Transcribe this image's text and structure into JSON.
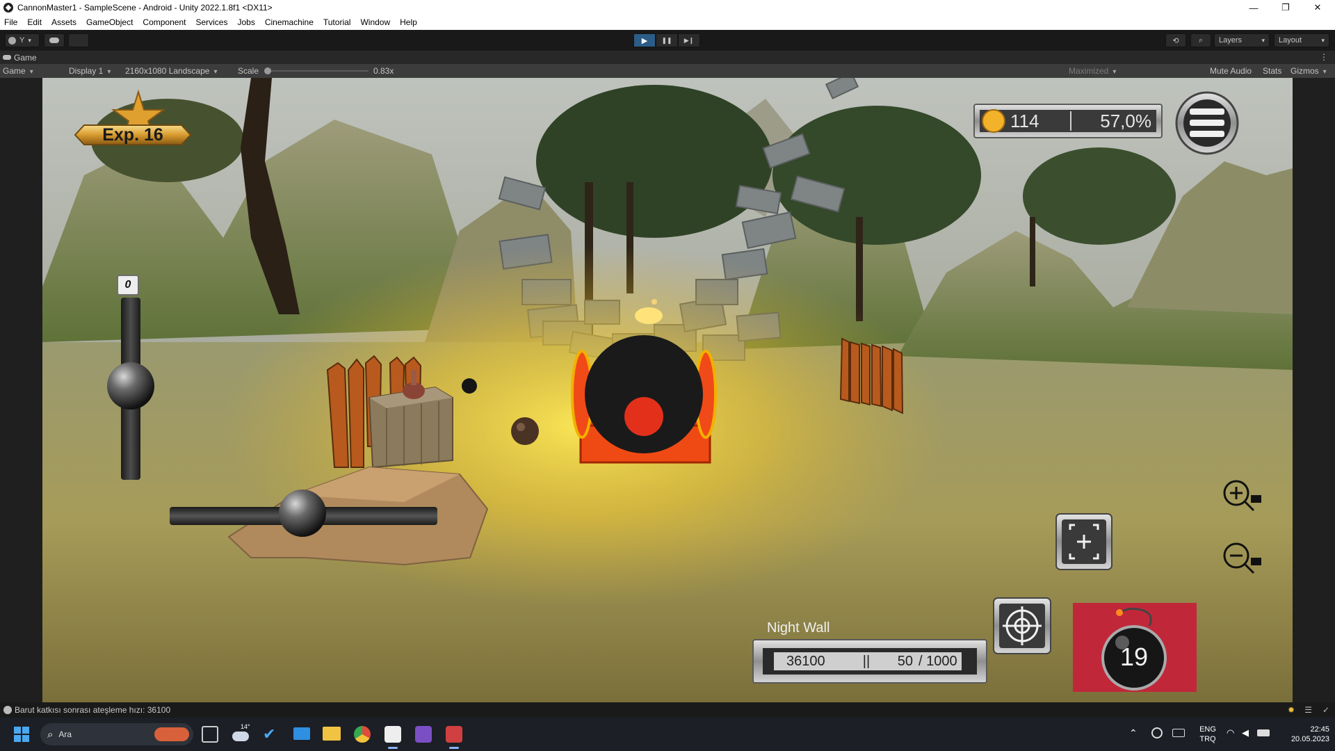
{
  "window": {
    "title": "CannonMaster1 - SampleScene - Android - Unity 2022.1.8f1 <DX11>",
    "controls": [
      "—",
      "❐",
      "✕"
    ]
  },
  "menu": [
    "File",
    "Edit",
    "Assets",
    "GameObject",
    "Component",
    "Services",
    "Jobs",
    "Cinemachine",
    "Tutorial",
    "Window",
    "Help"
  ],
  "toolbar": {
    "account_label": "Y",
    "layers_label": "Layers",
    "layout_label": "Layout",
    "play_icon": "▶",
    "pause_icon": "❚❚",
    "step_icon": "▶❙"
  },
  "game_view": {
    "tab_label": "Game",
    "view_select": "Game",
    "display_select": "Display 1",
    "resolution_select": "2160x1080 Landscape",
    "scale_label": "Scale",
    "scale_value": "0.83x",
    "scale_fraction": 0.0,
    "maximized_label": "Maximized",
    "mute_audio_label": "Mute Audio",
    "stats_label": "Stats",
    "gizmos_label": "Gizmos"
  },
  "hud": {
    "exp_label": "Exp. 16",
    "coins": "114",
    "percent": "57,0%",
    "vertical_slider_value": "0",
    "level_name": "Night Wall",
    "score": "36100",
    "separator": "||",
    "shots_current": "50",
    "shots_total": "/ 1000",
    "bomb_count": "19"
  },
  "status": {
    "message": "Barut katkısı sonrası ateşleme hızı: 36100"
  },
  "taskbar": {
    "search_label": "Ara",
    "weather_temp": "14°",
    "lang_top": "ENG",
    "lang_bottom": "TRQ",
    "time": "22:45",
    "date": "20.05.2023"
  },
  "colors": {
    "unity_play_active": "#2c5d87",
    "bomb_panel": "#c0283a",
    "cannon_body": "#1a1a1a",
    "cannon_wheel": "#e5391c"
  }
}
